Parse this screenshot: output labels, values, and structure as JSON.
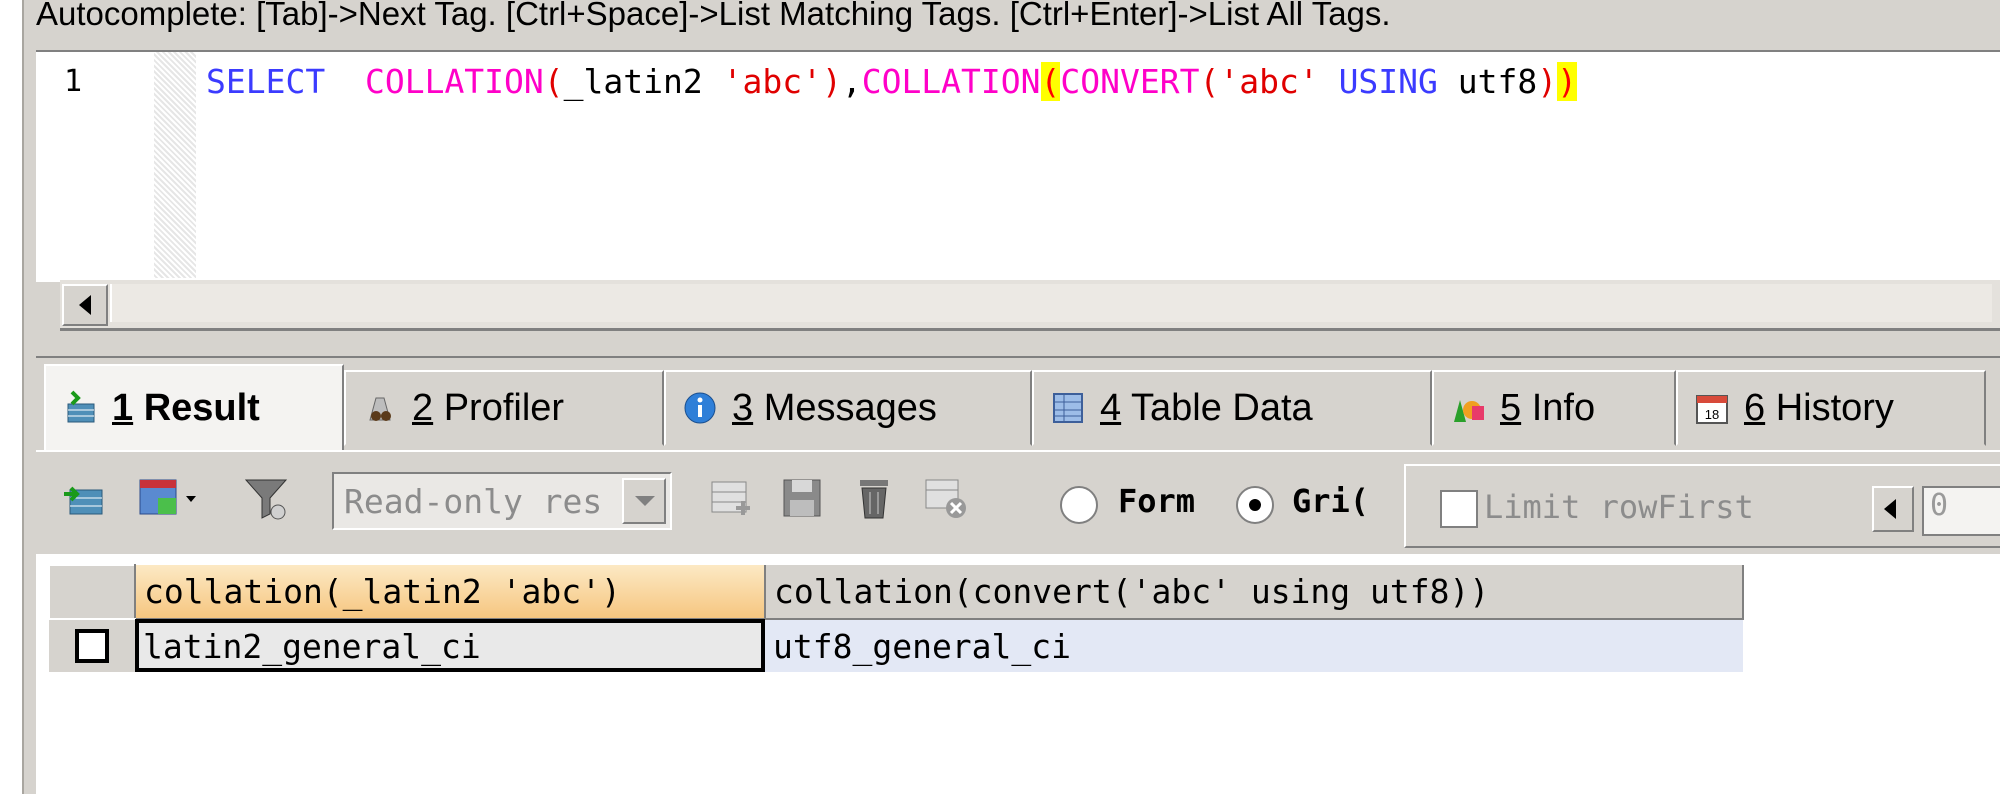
{
  "hint_bar": {
    "text": "Autocomplete: [Tab]->Next Tag. [Ctrl+Space]->List Matching Tags. [Ctrl+Enter]->List All Tags."
  },
  "editor": {
    "line_number": "1",
    "tokens": {
      "select": "SELECT",
      "collation1": "COLLATION",
      "paren1_open": "(",
      "charset_intro": "_latin2",
      "str1": "'abc'",
      "paren1_close": ")",
      "comma": ",",
      "collation2": "COLLATION",
      "paren2_open": "(",
      "convert": "CONVERT",
      "paren3_open": "(",
      "str2": "'abc'",
      "using": "USING",
      "utf8": "utf8",
      "paren3_close": ")",
      "paren2_close": ")"
    }
  },
  "tabs": [
    {
      "num": "1",
      "label": "Result",
      "active": true,
      "icon": "result-icon"
    },
    {
      "num": "2",
      "label": "Profiler",
      "active": false,
      "icon": "profiler-icon"
    },
    {
      "num": "3",
      "label": "Messages",
      "active": false,
      "icon": "info-icon"
    },
    {
      "num": "4",
      "label": "Table Data",
      "active": false,
      "icon": "table-icon"
    },
    {
      "num": "5",
      "label": "Info",
      "active": false,
      "icon": "shapes-icon"
    },
    {
      "num": "6",
      "label": "History",
      "active": false,
      "icon": "calendar-icon"
    }
  ],
  "toolbar": {
    "result_mode_value": "Read-only res",
    "form_label": "Form",
    "grid_label": "Gri(",
    "grid_selected": true,
    "limit_label": "Limit rowFirst",
    "first_value": "0",
    "calendar_day": "18"
  },
  "grid": {
    "columns": [
      "collation(_latin2 'abc')",
      "collation(convert('abc' using utf8))"
    ],
    "rows": [
      [
        "latin2_general_ci",
        "utf8_general_ci"
      ]
    ]
  },
  "colors": {
    "keyword": "#3b3bff",
    "function": "#ff00c8",
    "string": "#e00000",
    "match_highlight": "#ffff00",
    "chrome": "#d6d3ce"
  }
}
